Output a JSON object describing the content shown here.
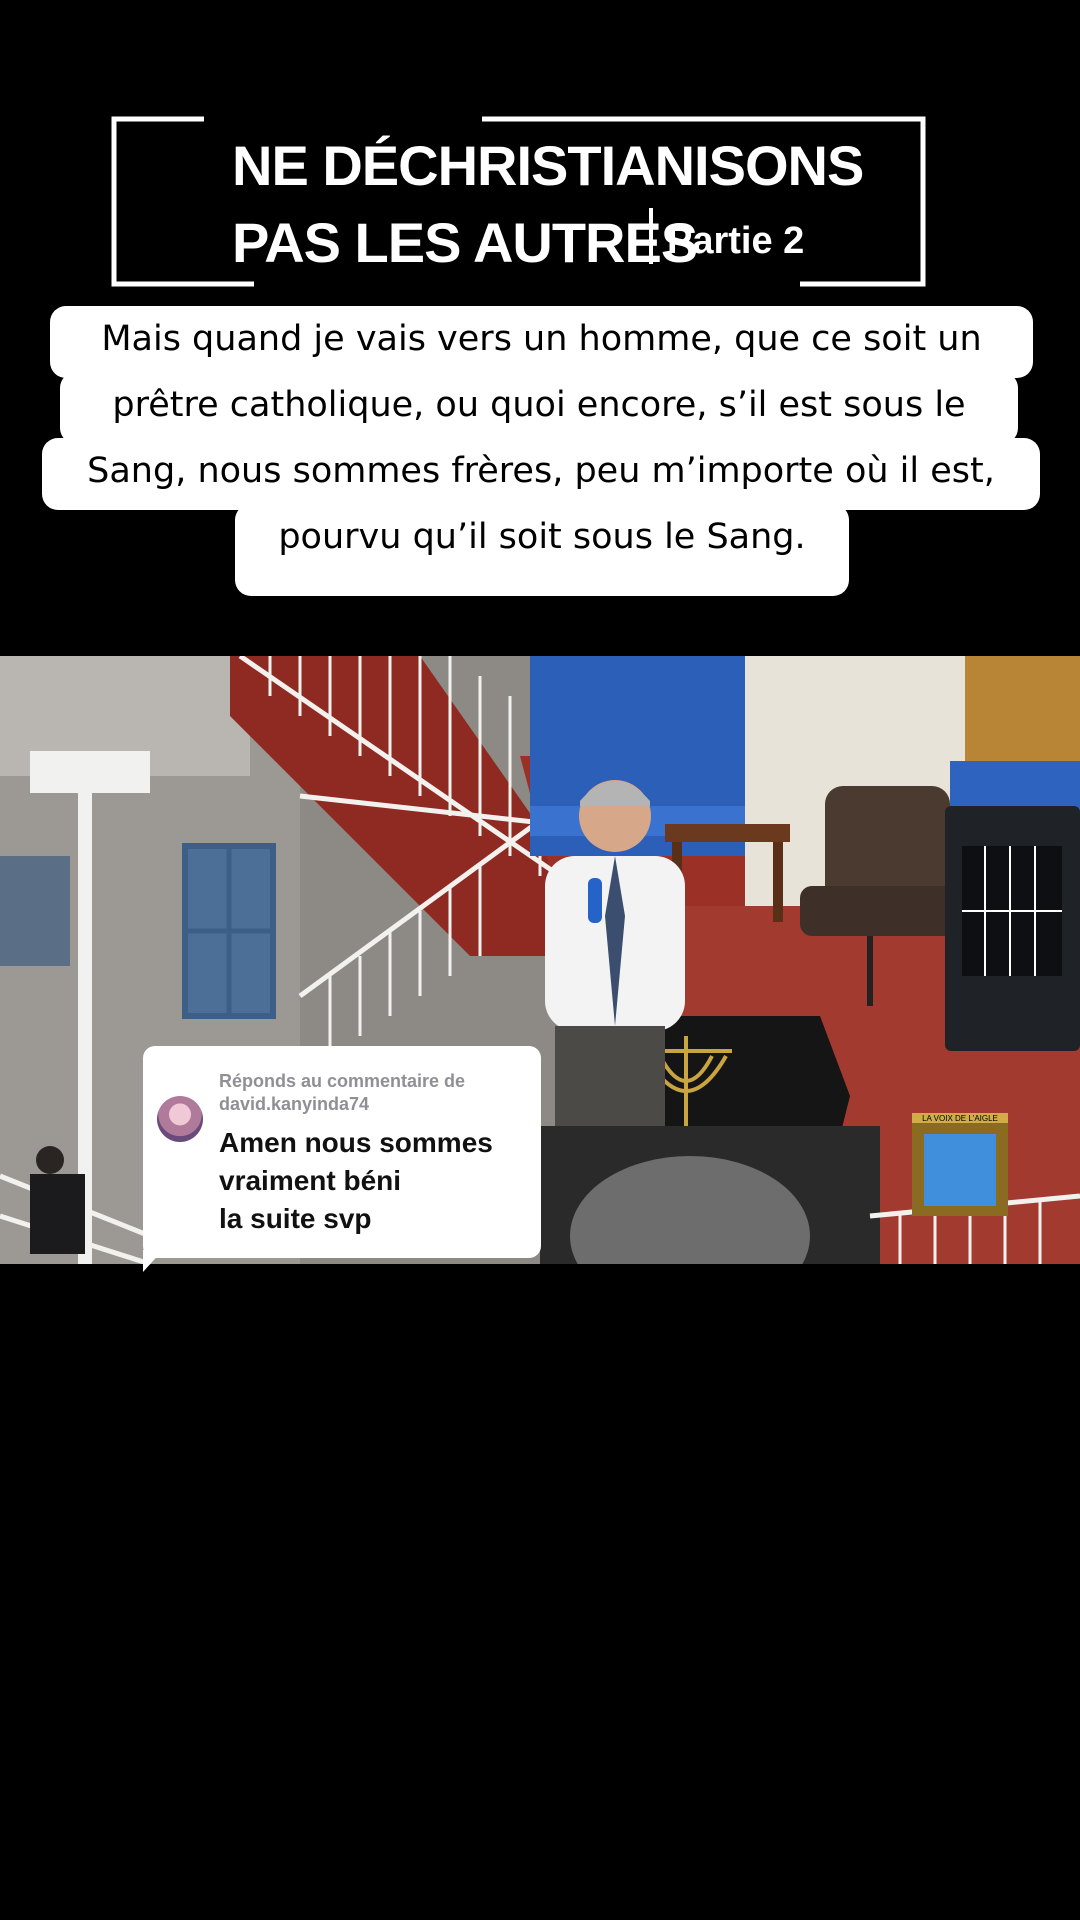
{
  "title": {
    "line1": "NE DÉCHRISTIANISONS",
    "line2": "PAS LES AUTRES",
    "part": "Partie 2"
  },
  "caption": {
    "lines": [
      "Mais quand je vais vers un homme, que ce soit un",
      "prêtre catholique, ou quoi encore, s’il est sous le",
      "Sang, nous sommes frères, peu m’importe où il est,",
      "pourvu qu’il soit sous le Sang."
    ]
  },
  "comment": {
    "reply_label": "Réponds au commentaire de david.kanyinda74",
    "text_lines": [
      "Amen nous sommes",
      "vraiment béni",
      "la suite svp"
    ]
  },
  "video": {
    "logo_text": "LA VOIX DE L'AIGLE"
  }
}
